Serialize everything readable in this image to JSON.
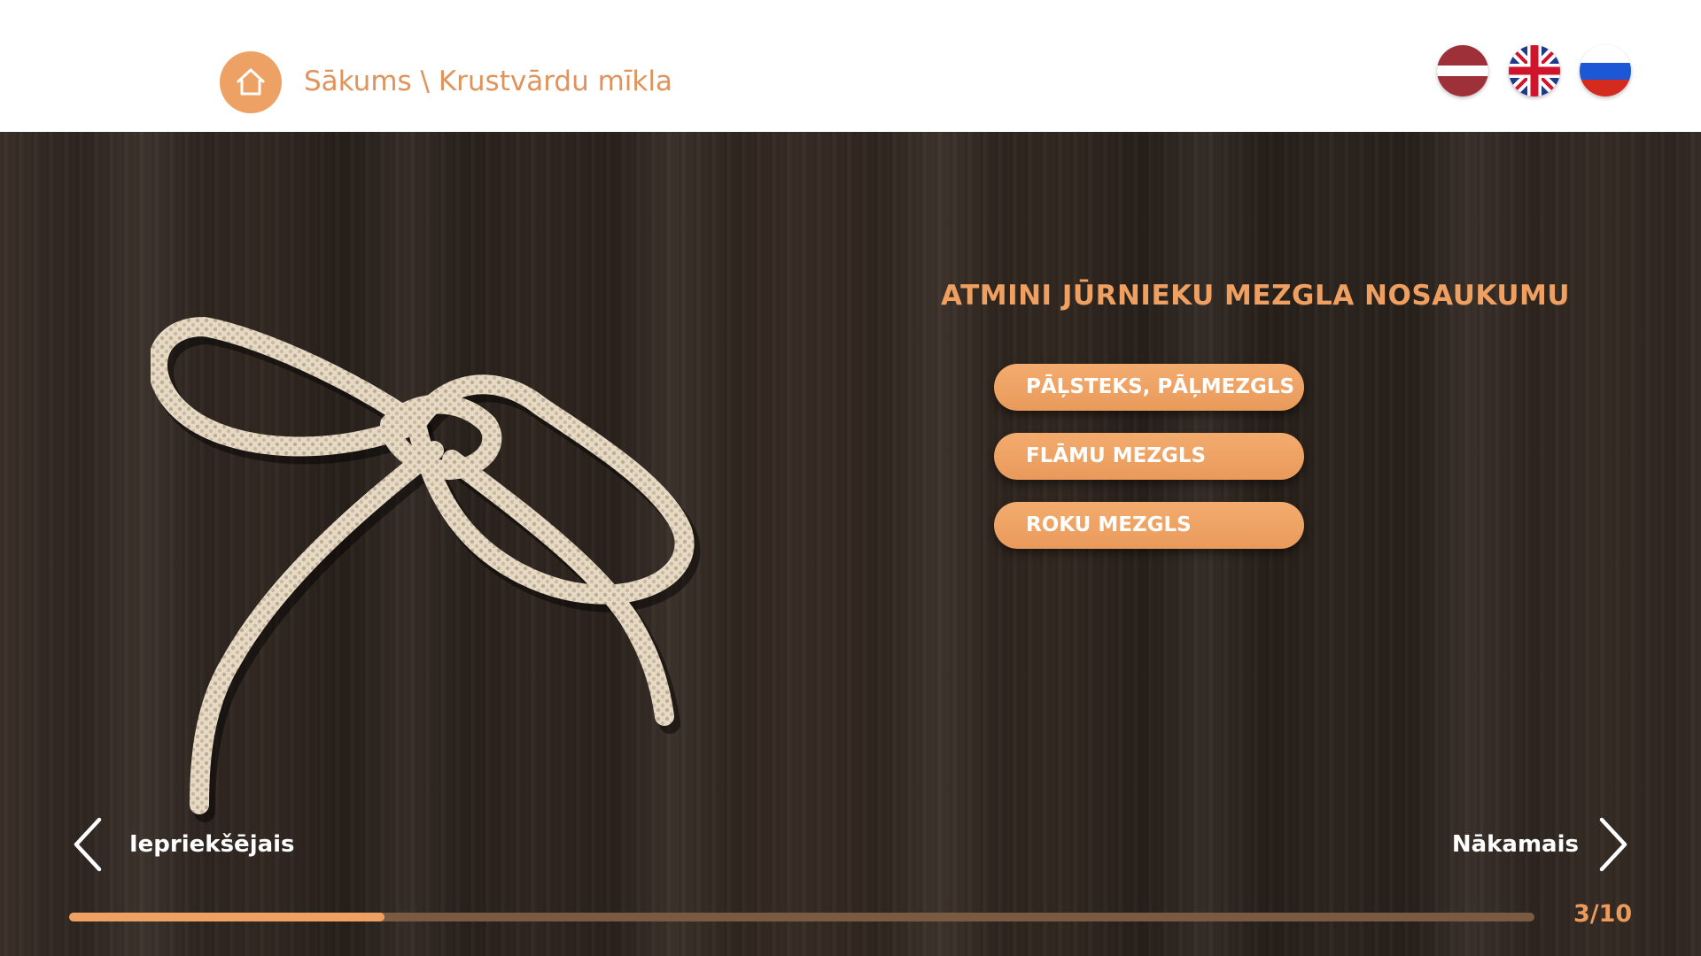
{
  "header": {
    "home_icon": "home-icon",
    "breadcrumb": "Sākums \\ Krustvārdu mīkla",
    "languages": [
      {
        "code": "lv",
        "icon": "flag-latvia-icon"
      },
      {
        "code": "en",
        "icon": "flag-uk-icon"
      },
      {
        "code": "ru",
        "icon": "flag-russia-icon"
      }
    ]
  },
  "quiz": {
    "image": "rope-knot-image",
    "question": "ATMINI JŪRNIEKU MEZGLA NOSAUKUMU",
    "answers": [
      {
        "label": "PĀĻSTEKS, PĀĻMEZGLS"
      },
      {
        "label": "FLĀMU MEZGLS"
      },
      {
        "label": "ROKU MEZGLS"
      }
    ]
  },
  "navigation": {
    "prev_label": "Iepriekšējais",
    "next_label": "Nākamais",
    "prev_icon": "chevron-left-icon",
    "next_icon": "chevron-right-icon"
  },
  "progress": {
    "current": 3,
    "total": 10,
    "fraction": 0.215,
    "text": "3/10"
  },
  "colors": {
    "accent": "#eda164",
    "accent_text": "#e0935a",
    "header_bg": "#ffffff",
    "wood_bg": "#2f2620"
  }
}
